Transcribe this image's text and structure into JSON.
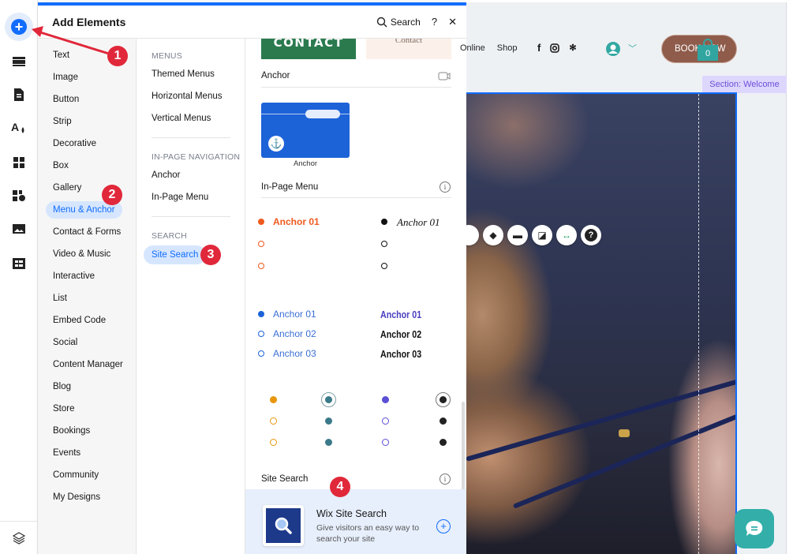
{
  "rail": {
    "items": [
      {
        "icon": "add-icon",
        "label": "Add Elements"
      },
      {
        "icon": "sections-icon"
      },
      {
        "icon": "pages-icon"
      },
      {
        "icon": "theme-icon"
      },
      {
        "icon": "apps-icon"
      },
      {
        "icon": "business-apps-icon"
      },
      {
        "icon": "media-icon"
      },
      {
        "icon": "cms-icon"
      }
    ],
    "bottom_icon": "layers-icon"
  },
  "panel": {
    "title": "Add Elements",
    "search_label": "Search",
    "help_label": "?",
    "close_label": "✕",
    "categories": [
      "Text",
      "Image",
      "Button",
      "Strip",
      "Decorative",
      "Box",
      "Gallery",
      "Menu & Anchor",
      "Contact & Forms",
      "Video & Music",
      "Interactive",
      "List",
      "Embed Code",
      "Social",
      "Content Manager",
      "Blog",
      "Store",
      "Bookings",
      "Events",
      "Community",
      "My Designs"
    ],
    "active_category": "Menu & Anchor",
    "subcategories": {
      "menus_heading": "MENUS",
      "menus": [
        "Themed Menus",
        "Horizontal Menus",
        "Vertical Menus"
      ],
      "inpage_heading": "IN-PAGE NAVIGATION",
      "inpage": [
        "Anchor",
        "In-Page Menu"
      ],
      "search_heading": "SEARCH",
      "search": [
        "Site Search"
      ],
      "active": "Site Search"
    },
    "gallery": {
      "contact_green": "CONTACT",
      "contact_beige": "Contact",
      "anchor_section": "Anchor",
      "anchor_thumb_caption": "Anchor",
      "inpage_menu_section": "In-Page Menu",
      "inpage_styles": [
        {
          "label": "Anchor 01",
          "color": "#ee5a1f"
        },
        {
          "label": "Anchor 01",
          "color": "#111111"
        }
      ],
      "inpage_lists": [
        {
          "items": [
            "Anchor 01",
            "Anchor 02",
            "Anchor 03"
          ],
          "color": "#3b6fd6"
        },
        {
          "items": [
            "Anchor 01",
            "Anchor 02",
            "Anchor 03"
          ],
          "active_color": "#4a3fc0",
          "color": "#111111"
        }
      ],
      "dot_colors": [
        "#e8960c",
        "#3a7a8a",
        "#5b4fd6",
        "#222222"
      ],
      "site_search_section": "Site Search",
      "site_search_card": {
        "title": "Wix Site Search",
        "description": "Give visitors an easy way to search your site",
        "add_label": "+"
      }
    }
  },
  "site": {
    "nav": [
      "Online",
      "Shop"
    ],
    "social": [
      "facebook-icon",
      "instagram-icon",
      "yelp-icon"
    ],
    "book_button": "BOOK NOW",
    "cart_count": "0",
    "section_label": "Section: Welcome"
  },
  "callouts": [
    "1",
    "2",
    "3",
    "4"
  ],
  "colors": {
    "accent": "#116dff",
    "callout": "#e0283a",
    "book_button": "#8f5c4b",
    "teal": "#33aea9",
    "section_tag": "#6b4fd8"
  }
}
